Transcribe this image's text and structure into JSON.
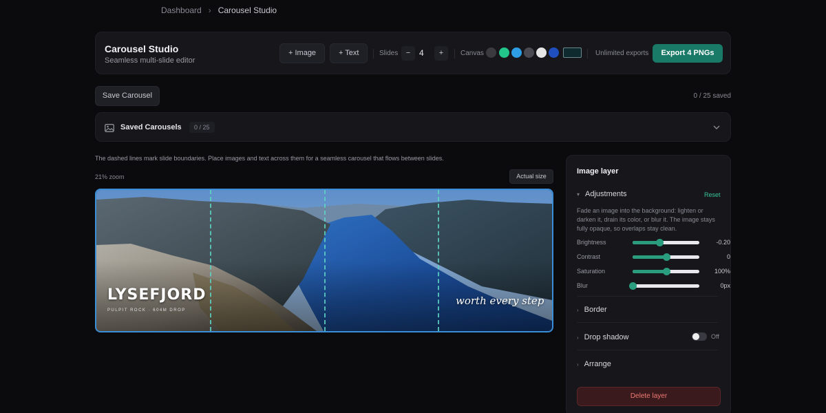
{
  "breadcrumb": {
    "items": [
      "Dashboard",
      "Carousel Studio"
    ]
  },
  "header": {
    "title": "Carousel Studio",
    "subtitle": "Seamless multi-slide editor",
    "add_image_label": "+ Image",
    "add_text_label": "+ Text",
    "slides_label": "Slides",
    "slides_decrement": "−",
    "slides_count": "4",
    "slides_increment": "+",
    "canvas_label": "Canvas",
    "canvas_swatches": [
      "#3a3a3f",
      "#22c58a",
      "#2f9de3",
      "#4a4a52",
      "#e6e6e6",
      "#1f4fbf"
    ],
    "canvas_selected_color": "#0f2a2e",
    "exports_label": "Unlimited exports",
    "export_button": "Export 4 PNGs"
  },
  "toolbar": {
    "save_carousel": "Save Carousel",
    "saved_count": "0 / 25 saved"
  },
  "saved_panel": {
    "title": "Saved Carousels",
    "badge": "0 / 25"
  },
  "editor": {
    "hint": "The dashed lines mark slide boundaries. Place images and text across them for a seamless carousel that flows between slides.",
    "zoom": "21% zoom",
    "actual_size": "Actual size",
    "canvas": {
      "headline": "LYSEFJORD",
      "subline": "PULPIT ROCK · 604M DROP",
      "tagline": "worth every step",
      "slide_count": 4,
      "accent": "#3a8fd8",
      "divider_color": "#5fd3c4"
    }
  },
  "layer_panel": {
    "title": "Image layer",
    "adjustments": {
      "label": "Adjustments",
      "reset": "Reset",
      "description": "Fade an image into the background: lighten or darken it, drain its color, or blur it. The image stays fully opaque, so overlaps stay clean.",
      "sliders": [
        {
          "label": "Brightness",
          "value": "-0.20",
          "level": 0.4
        },
        {
          "label": "Contrast",
          "value": "0",
          "level": 0.5
        },
        {
          "label": "Saturation",
          "value": "100%",
          "level": 0.5
        },
        {
          "label": "Blur",
          "value": "0px",
          "level": 0.0
        }
      ]
    },
    "border_label": "Border",
    "drop_shadow": {
      "label": "Drop shadow",
      "state": "Off"
    },
    "arrange_label": "Arrange",
    "delete_label": "Delete layer"
  }
}
